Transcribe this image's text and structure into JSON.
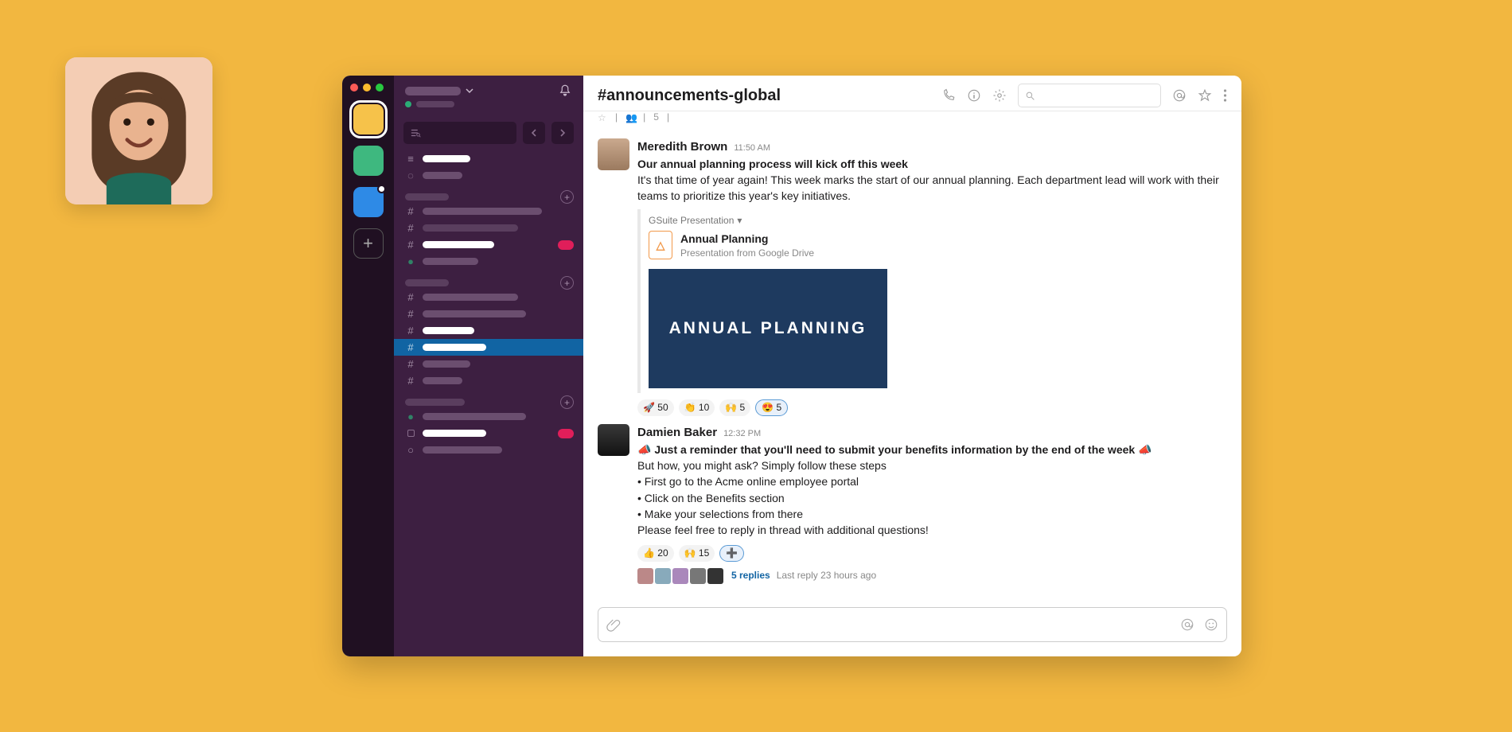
{
  "workspaces": [
    {
      "color": "#f6c24a",
      "active": true
    },
    {
      "color": "#3eb87f",
      "active": false
    },
    {
      "color": "#2e8ae6",
      "active": false,
      "badge": true
    }
  ],
  "channel": {
    "title": "#announcements-global",
    "subMembers": "5"
  },
  "messages": [
    {
      "author": "Meredith Brown",
      "time": "11:50 AM",
      "titleLine": "Our annual planning process will kick off this week",
      "body": "It's that time of year again! This week marks the start of our annual planning. Each department lead will work with their teams to prioritize this year's key initiatives.",
      "attachment": {
        "source": "GSuite Presentation",
        "title": "Annual Planning",
        "subtitle": "Presentation from Google Drive",
        "slideText": "ANNUAL PLANNING"
      },
      "reactions": [
        {
          "emoji": "🚀",
          "count": "50"
        },
        {
          "emoji": "👏",
          "count": "10"
        },
        {
          "emoji": "🙌",
          "count": "5"
        },
        {
          "emoji": "😍",
          "count": "5",
          "add": true
        }
      ]
    },
    {
      "author": "Damien Baker",
      "time": "12:32 PM",
      "titleLine": "📣 Just a reminder that you'll need to submit your benefits information by the end of the week 📣",
      "body": "But how, you might ask? Simply follow these steps",
      "bullets": [
        "• First go to the Acme online employee portal",
        "• Click on the Benefits section",
        "• Make your selections from there"
      ],
      "closing": "Please feel free to reply in thread with additional questions!",
      "reactions": [
        {
          "emoji": "👍",
          "count": "20"
        },
        {
          "emoji": "🙌",
          "count": "15"
        },
        {
          "emoji": "➕",
          "count": "",
          "add": true
        }
      ],
      "thread": {
        "replies": "5 replies",
        "ago": "Last reply 23 hours ago"
      }
    }
  ]
}
